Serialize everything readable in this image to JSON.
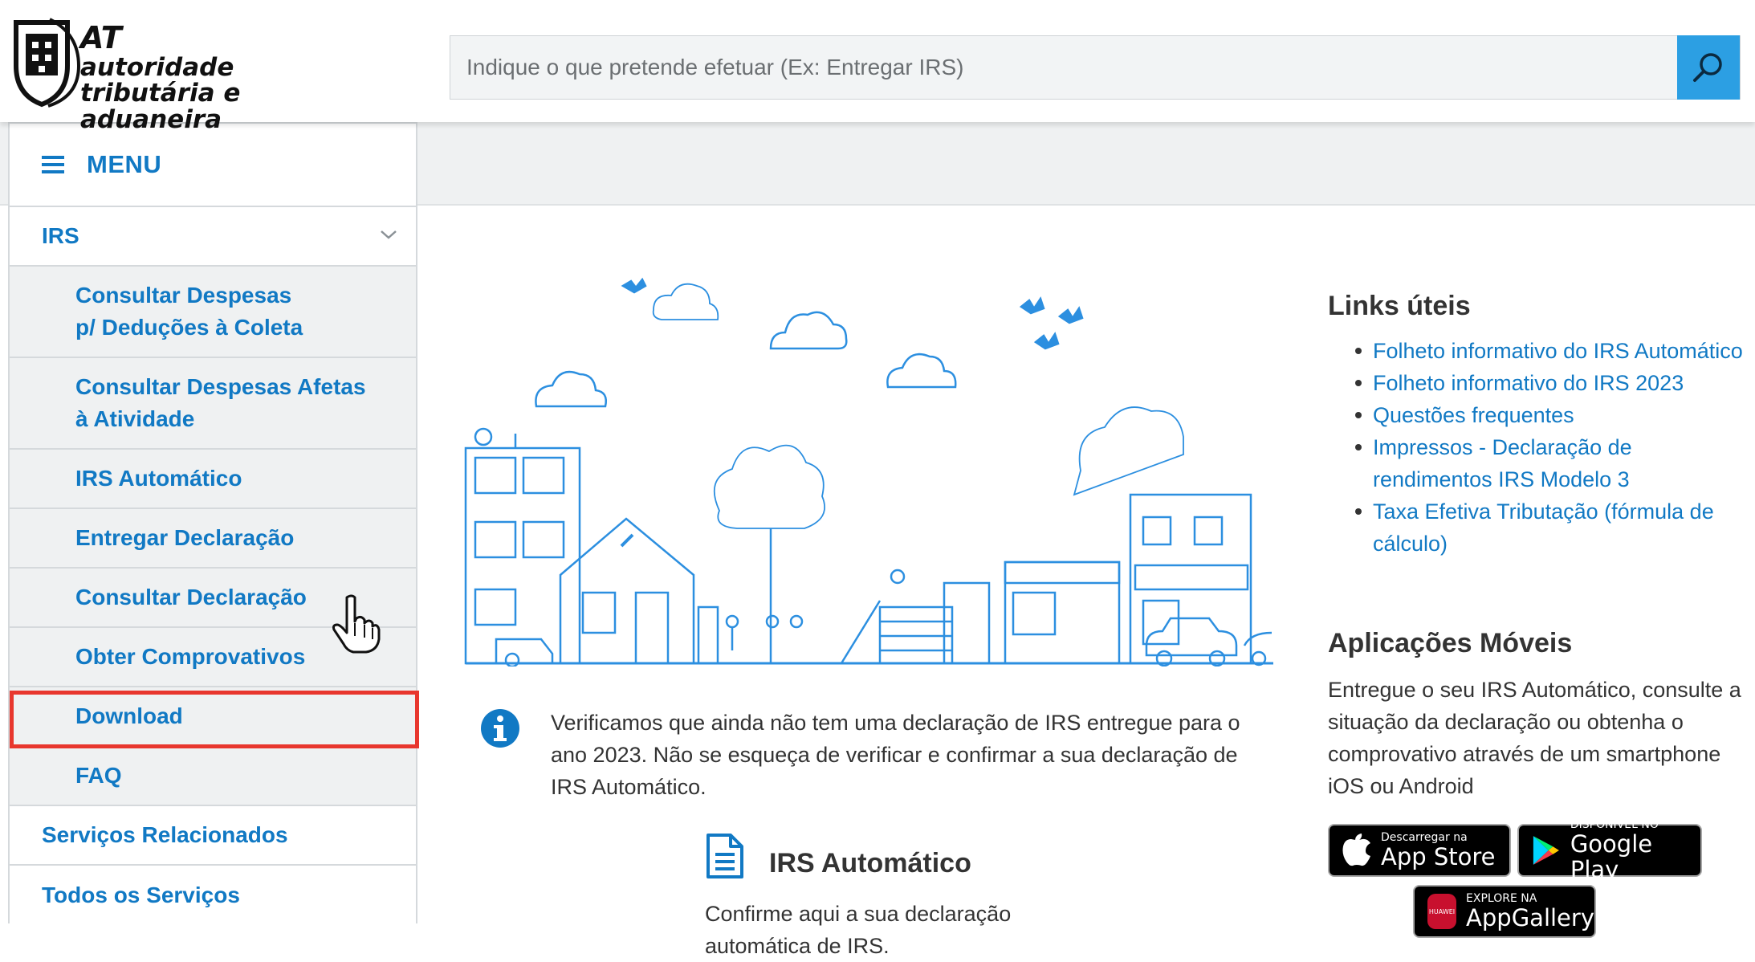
{
  "header": {
    "logo": {
      "line1": "AT",
      "line2": "autoridade",
      "line3": "tributária e aduaneira"
    },
    "search_placeholder": "Indique o que pretende efetuar (Ex: Entregar IRS)"
  },
  "sidebar": {
    "menu_label": "MENU",
    "section": "IRS",
    "sub_items": [
      "Consultar Despesas p/ Deduções à Coleta",
      "Consultar Despesas Afetas à Atividade",
      "IRS Automático",
      "Entregar Declaração",
      "Consultar Declaração",
      "Obter Comprovativos",
      "Download",
      "FAQ"
    ],
    "bottom_items": [
      "Serviços Relacionados",
      "Todos os Serviços"
    ]
  },
  "main": {
    "notice": "Verificamos que ainda não tem uma declaração de IRS entregue para o ano 2023. Não se esqueça de verificar e confirmar a sua declaração de IRS Automático.",
    "irs_auto_title": "IRS Automático",
    "irs_auto_desc": "Confirme aqui a sua declaração automática de IRS."
  },
  "links": {
    "title": "Links úteis",
    "items": [
      "Folheto informativo do IRS Automático",
      "Folheto informativo do IRS 2023",
      "Questões frequentes",
      "Impressos - Declaração de rendimentos IRS Modelo 3",
      "Taxa Efetiva Tributação (fórmula de cálculo)"
    ]
  },
  "apps": {
    "title": "Aplicações Móveis",
    "text": "Entregue o seu IRS Automático, consulte a situação da declaração ou obtenha o comprovativo através de um smartphone iOS ou Android",
    "appstore_small": "Descarregar na",
    "appstore_big": "App Store",
    "googleplay_small": "DISPONÍVEL NO",
    "googleplay_big": "Google Play",
    "appgallery_small": "EXPLORE NA",
    "appgallery_big": "AppGallery",
    "huawei_label": "HUAWEI"
  },
  "colors": {
    "link_blue": "#1179c4",
    "accent_blue": "#2c9fe3",
    "highlight_red": "#e8372e"
  }
}
